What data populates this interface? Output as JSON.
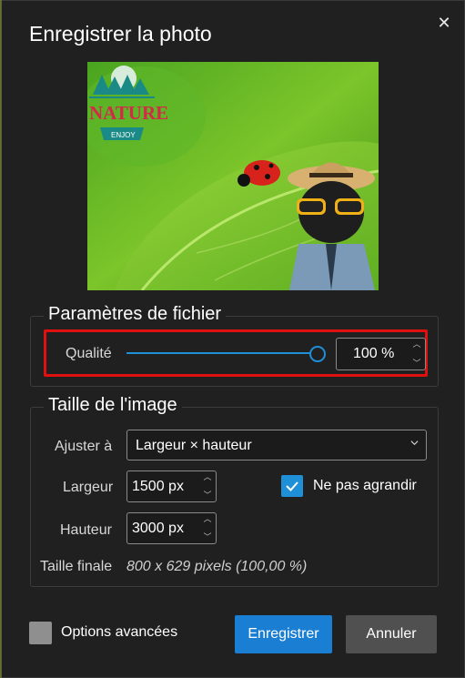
{
  "dialog": {
    "title": "Enregistrer la photo",
    "close_icon": "close-icon"
  },
  "preview": {
    "logo_text": "NATURE",
    "logo_subtext": "ENJOY"
  },
  "file_params": {
    "legend": "Paramètres de fichier",
    "quality_label": "Qualité",
    "quality_value": "100 %",
    "quality_level": 1.0,
    "highlight_color": "#e01010"
  },
  "image_size": {
    "legend": "Taille de l'image",
    "fit_label": "Ajuster à",
    "fit_value": "Largeur × hauteur",
    "width_label": "Largeur",
    "width_value": "1500 px",
    "height_label": "Hauteur",
    "height_value": "3000 px",
    "no_enlarge_label": "Ne pas agrandir",
    "no_enlarge_checked": true,
    "final_label": "Taille finale",
    "final_value": "800 x 629 pixels (100,00 %)"
  },
  "footer": {
    "advanced_label": "Options avancées",
    "advanced_checked": false,
    "save_label": "Enregistrer",
    "cancel_label": "Annuler"
  },
  "colors": {
    "accent": "#1a7ed3",
    "background": "#202020"
  }
}
